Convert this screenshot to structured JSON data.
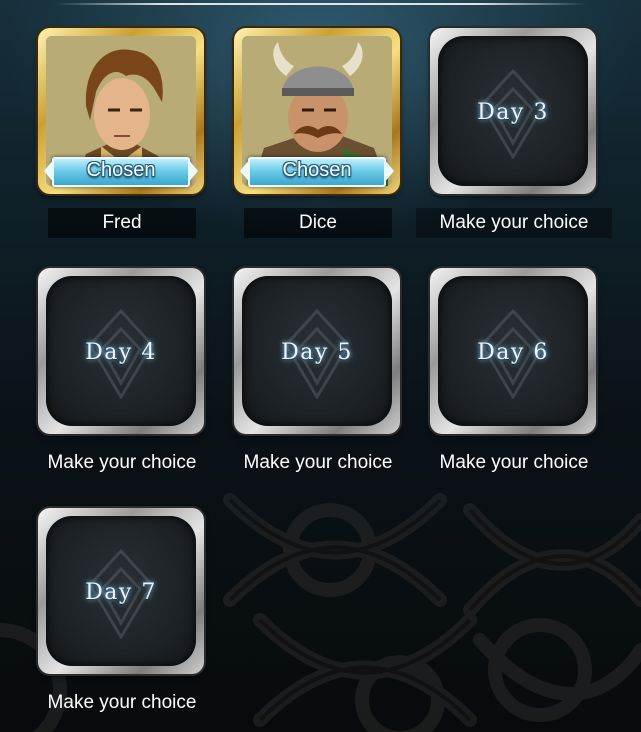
{
  "slots": [
    {
      "type": "chosen",
      "name": "Fred",
      "badge": "Chosen"
    },
    {
      "type": "chosen",
      "name": "Dice",
      "badge": "Chosen"
    },
    {
      "type": "empty",
      "day": "Day 3",
      "prompt": "Make your choice"
    },
    {
      "type": "empty",
      "day": "Day 4",
      "prompt": "Make your choice"
    },
    {
      "type": "empty",
      "day": "Day 5",
      "prompt": "Make your choice"
    },
    {
      "type": "empty",
      "day": "Day 6",
      "prompt": "Make your choice"
    },
    {
      "type": "empty",
      "day": "Day 7",
      "prompt": "Make your choice"
    }
  ],
  "colors": {
    "chosen_frame": "#d4ab43",
    "empty_frame": "#c8c8c8",
    "badge": "#6ecbe8",
    "background": "#0f2029"
  }
}
